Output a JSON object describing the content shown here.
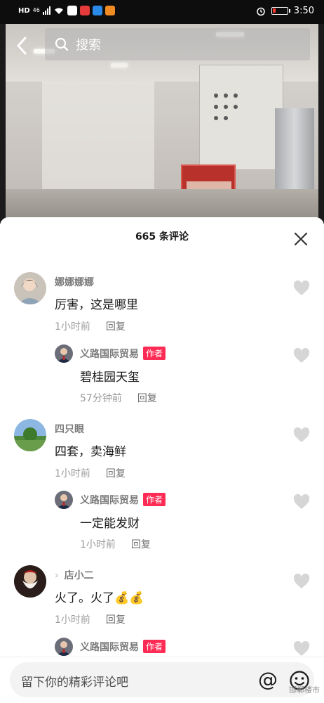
{
  "status_bar": {
    "hd": "HD",
    "network": "46",
    "time": "3:50",
    "battery_level": 0.2,
    "battery_color": "#ff3b30"
  },
  "header": {
    "search_label": "搜索"
  },
  "comments_panel": {
    "title": "665 条评论",
    "comments": [
      {
        "name": "娜娜娜娜",
        "text": "厉害，这是哪里",
        "time": "1小时前",
        "reply_label": "回复"
      },
      {
        "name": "义路国际贸易",
        "badge": "作者",
        "text": "碧桂园天玺",
        "time": "57分钟前",
        "reply_label": "回复"
      },
      {
        "name": "四只眼",
        "text": "四套，卖海鲜",
        "time": "1小时前",
        "reply_label": "回复"
      },
      {
        "name": "义路国际贸易",
        "badge": "作者",
        "text": "一定能发财",
        "time": "1小时前",
        "reply_label": "回复"
      },
      {
        "name": "店小二",
        "text": "火了。火了",
        "emoji": "💰💰",
        "time": "1小时前",
        "reply_label": "回复"
      },
      {
        "name": "义路国际贸易",
        "badge": "作者"
      }
    ]
  },
  "input_bar": {
    "placeholder": "留下你的精彩评论吧",
    "at_symbol": "@",
    "watermark": "邯郸楼市"
  },
  "colors": {
    "accent": "#fe2c55",
    "heart_gray": "#d6d6d6"
  }
}
